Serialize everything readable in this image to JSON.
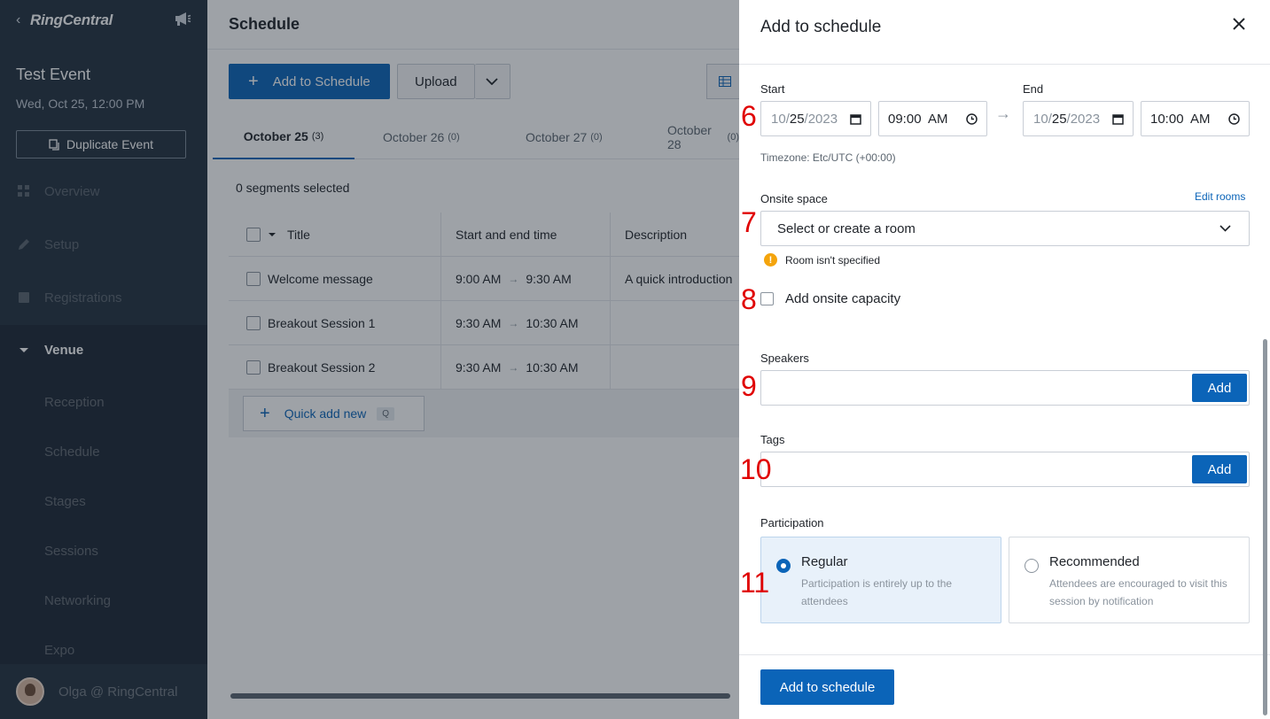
{
  "sidebar": {
    "logo": "RingCentral",
    "event_title": "Test Event",
    "event_date": "Wed, Oct 25, 12:00 PM",
    "duplicate_label": "Duplicate Event",
    "nav": [
      "Overview",
      "Setup",
      "Registrations"
    ],
    "venue_label": "Venue",
    "venue_items": [
      "Reception",
      "Schedule",
      "Stages",
      "Sessions",
      "Networking",
      "Expo"
    ],
    "user": "Olga @ RingCentral"
  },
  "main": {
    "title": "Schedule",
    "add_button": "Add to Schedule",
    "upload_button": "Upload",
    "tabs": [
      {
        "label": "October 25",
        "count": "(3)"
      },
      {
        "label": "October 26",
        "count": "(0)"
      },
      {
        "label": "October 27",
        "count": "(0)"
      },
      {
        "label": "October 28",
        "count": "(0)"
      }
    ],
    "segments_selected": "0 segments selected",
    "columns": [
      "Title",
      "Start and end time",
      "Description"
    ],
    "rows": [
      {
        "title": "Welcome message",
        "start": "9:00 AM",
        "end": "9:30 AM",
        "description": "A quick introduction"
      },
      {
        "title": "Breakout Session 1",
        "start": "9:30 AM",
        "end": "10:30 AM",
        "description": ""
      },
      {
        "title": "Breakout Session 2",
        "start": "9:30 AM",
        "end": "10:30 AM",
        "description": ""
      }
    ],
    "quick_add": "Quick add new",
    "quick_add_key": "Q"
  },
  "drawer": {
    "title": "Add to schedule",
    "start_label": "Start",
    "end_label": "End",
    "start_date": {
      "month": "10",
      "day": "25",
      "year": "2023"
    },
    "start_time": "09:00  AM",
    "end_date": {
      "month": "10",
      "day": "25",
      "year": "2023"
    },
    "end_time": "10:00  AM",
    "timezone": "Timezone: Etc/UTC (+00:00)",
    "onsite_label": "Onsite space",
    "edit_rooms": "Edit rooms",
    "room_placeholder": "Select or create a room",
    "room_warning": "Room isn't specified",
    "capacity_label": "Add onsite capacity",
    "speakers_label": "Speakers",
    "tags_label": "Tags",
    "add_label": "Add",
    "participation_label": "Participation",
    "participation": [
      {
        "title": "Regular",
        "desc": "Participation is entirely up to the attendees",
        "selected": true
      },
      {
        "title": "Recommended",
        "desc": "Attendees are encouraged to visit this session by notification",
        "selected": false
      }
    ],
    "submit": "Add to schedule"
  },
  "annotations": [
    "6",
    "7",
    "8",
    "9",
    "10",
    "11"
  ],
  "colors": {
    "accent": "#0b64b8",
    "sidebar": "#24313f",
    "warning": "#f4a40c",
    "annotation": "#e00000"
  }
}
